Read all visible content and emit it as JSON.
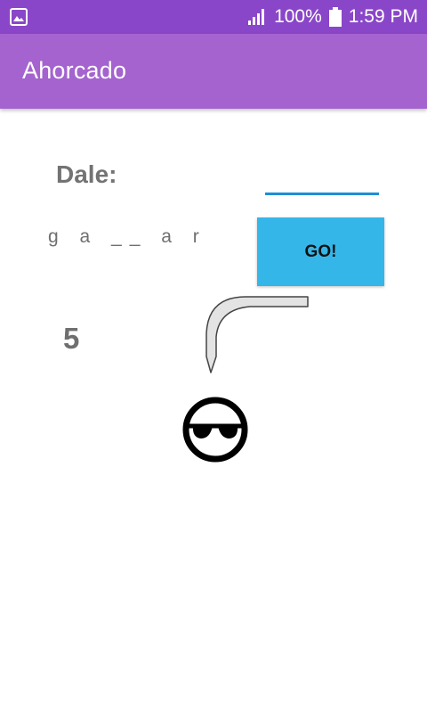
{
  "status_bar": {
    "battery_percent": "100%",
    "time": "1:59 PM",
    "icons": [
      "image-notification-icon",
      "signal-icon",
      "battery-icon"
    ]
  },
  "app_bar": {
    "title": "Ahorcado"
  },
  "game": {
    "prompt_label": "Dale:",
    "guess_input": {
      "value": "",
      "placeholder": ""
    },
    "word_display": "g a __ a r",
    "go_button_label": "GO!",
    "attempts_left": "5"
  },
  "colors": {
    "status_bar": "#8a46c8",
    "app_bar": "#a463cf",
    "go_button": "#35b6e8",
    "input_underline": "#1e8fd6",
    "text_gray": "#737373"
  }
}
